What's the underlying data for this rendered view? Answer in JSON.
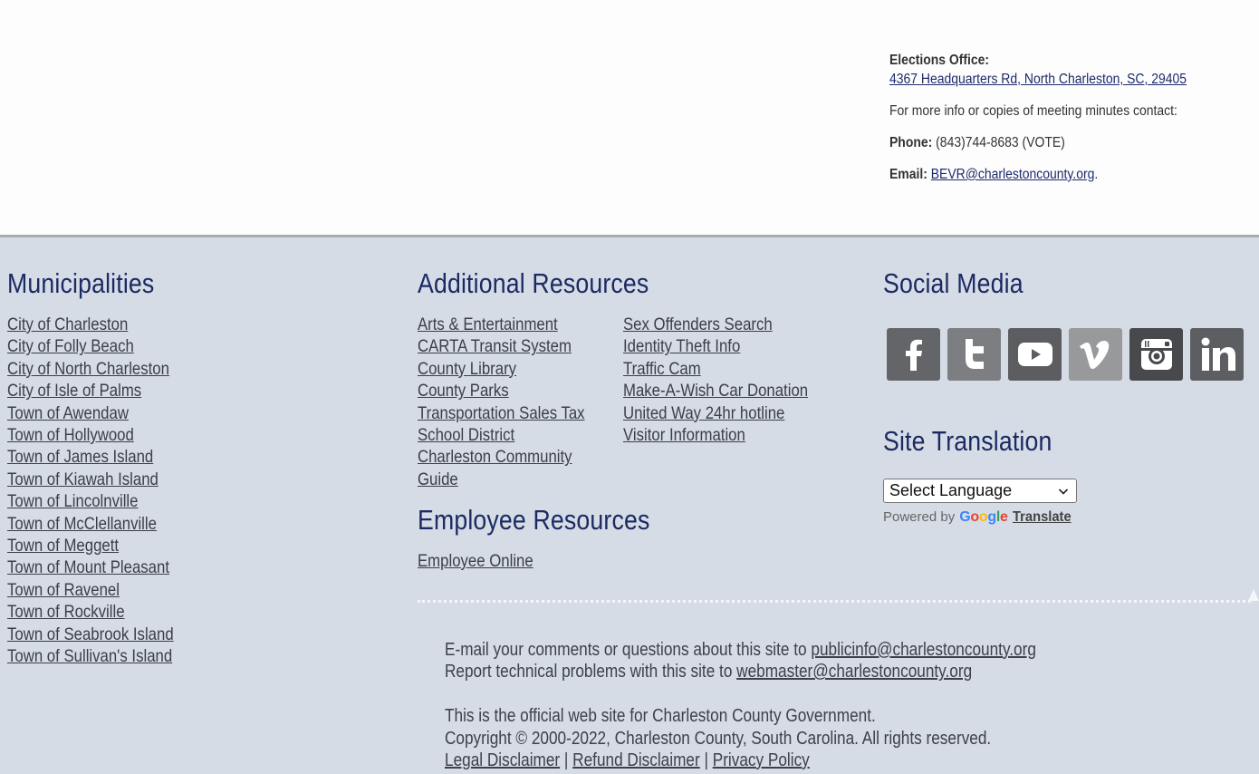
{
  "elections": {
    "office_label": "Elections Office:",
    "address": "4367 Headquarters Rd, North Charleston, SC, 29405",
    "contact_note": "For more info or copies of meeting minutes contact:",
    "phone_label": "Phone:",
    "phone_value": "(843)744-8683 (VOTE)",
    "email_label": "Email:",
    "email_value": "BEVR@charlestoncounty.org",
    "email_suffix": "."
  },
  "municipalities": {
    "title": "Municipalities",
    "items": [
      "City of Charleston",
      "City of Folly Beach",
      "City of North Charleston",
      "City of Isle of Palms",
      "Town of Awendaw",
      "Town of Hollywood",
      "Town of James Island",
      "Town of Kiawah Island",
      "Town of Lincolnville",
      "Town of McClellanville",
      "Town of Meggett",
      "Town of Mount Pleasant",
      "Town of Ravenel",
      "Town of Rockville",
      "Town of Seabrook Island",
      "Town of Sullivan's Island"
    ]
  },
  "additional_resources": {
    "title": "Additional Resources",
    "column1": [
      "Arts & Entertainment",
      "CARTA Transit System",
      "County Library",
      "County Parks",
      "Transportation Sales Tax",
      "School District",
      "Charleston Community",
      "Guide"
    ],
    "column2": [
      "Sex Offenders Search",
      "Identity Theft Info",
      "Traffic Cam",
      "Make-A-Wish Car Donation",
      "United Way 24hr hotline",
      "Visitor Information"
    ]
  },
  "employee_resources": {
    "title": "Employee Resources",
    "items": [
      "Employee Online"
    ]
  },
  "social_media": {
    "title": "Social Media",
    "icons": [
      "facebook-icon",
      "twitter-icon",
      "youtube-icon",
      "vimeo-icon",
      "instagram-icon",
      "linkedin-icon"
    ]
  },
  "site_translation": {
    "title": "Site Translation",
    "select_value": "Select Language",
    "powered_by": "Powered by",
    "google_letters": [
      "G",
      "o",
      "o",
      "g",
      "l",
      "e"
    ],
    "translate_link": "Translate"
  },
  "legal": {
    "email_comments_text": "E-mail your comments or questions about this site to ",
    "email_comments_link": "publicinfo@charlestoncounty.org",
    "report_text": "Report technical problems with this site to ",
    "report_link": "webmaster@charlestoncounty.org",
    "official_text": "This is the official web site for Charleston County Government.",
    "copyright_text": "Copyright © 2000-2022, Charleston County, South Carolina. All rights reserved.",
    "links": [
      "Legal Disclaimer",
      "Refund Disclaimer",
      "Privacy Policy"
    ],
    "separator": " | "
  },
  "colors": {
    "heading": "#1b2a63",
    "footer_bg": "#d5dce5",
    "link": "#3b3f45",
    "address_link": "#1d2a6b"
  }
}
